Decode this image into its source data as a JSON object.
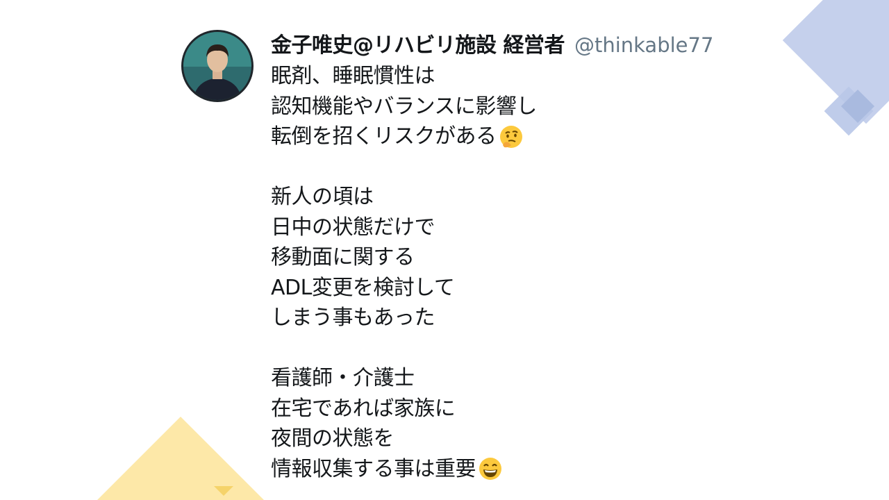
{
  "tweet": {
    "author_name": "金子唯史@リハビリ施設 経営者",
    "handle": "@thinkable77",
    "lines": [
      "眠剤、睡眠慣性は",
      "認知機能やバランスに影響し",
      "転倒を招くリスクがある",
      "",
      "新人の頃は",
      "日中の状態だけで",
      "移動面に関する",
      "ADL変更を検討して",
      "しまう事もあった",
      "",
      "看護師・介護士",
      "在宅であれば家族に",
      "夜間の状態を",
      "情報収集する事は重要"
    ],
    "emoji_line3": "thinking-face-emoji",
    "emoji_last": "grinning-face-emoji"
  },
  "colors": {
    "deco_blue": "#c5d0ec",
    "deco_yellow": "#fbe7a3",
    "handle_gray": "#657786"
  }
}
